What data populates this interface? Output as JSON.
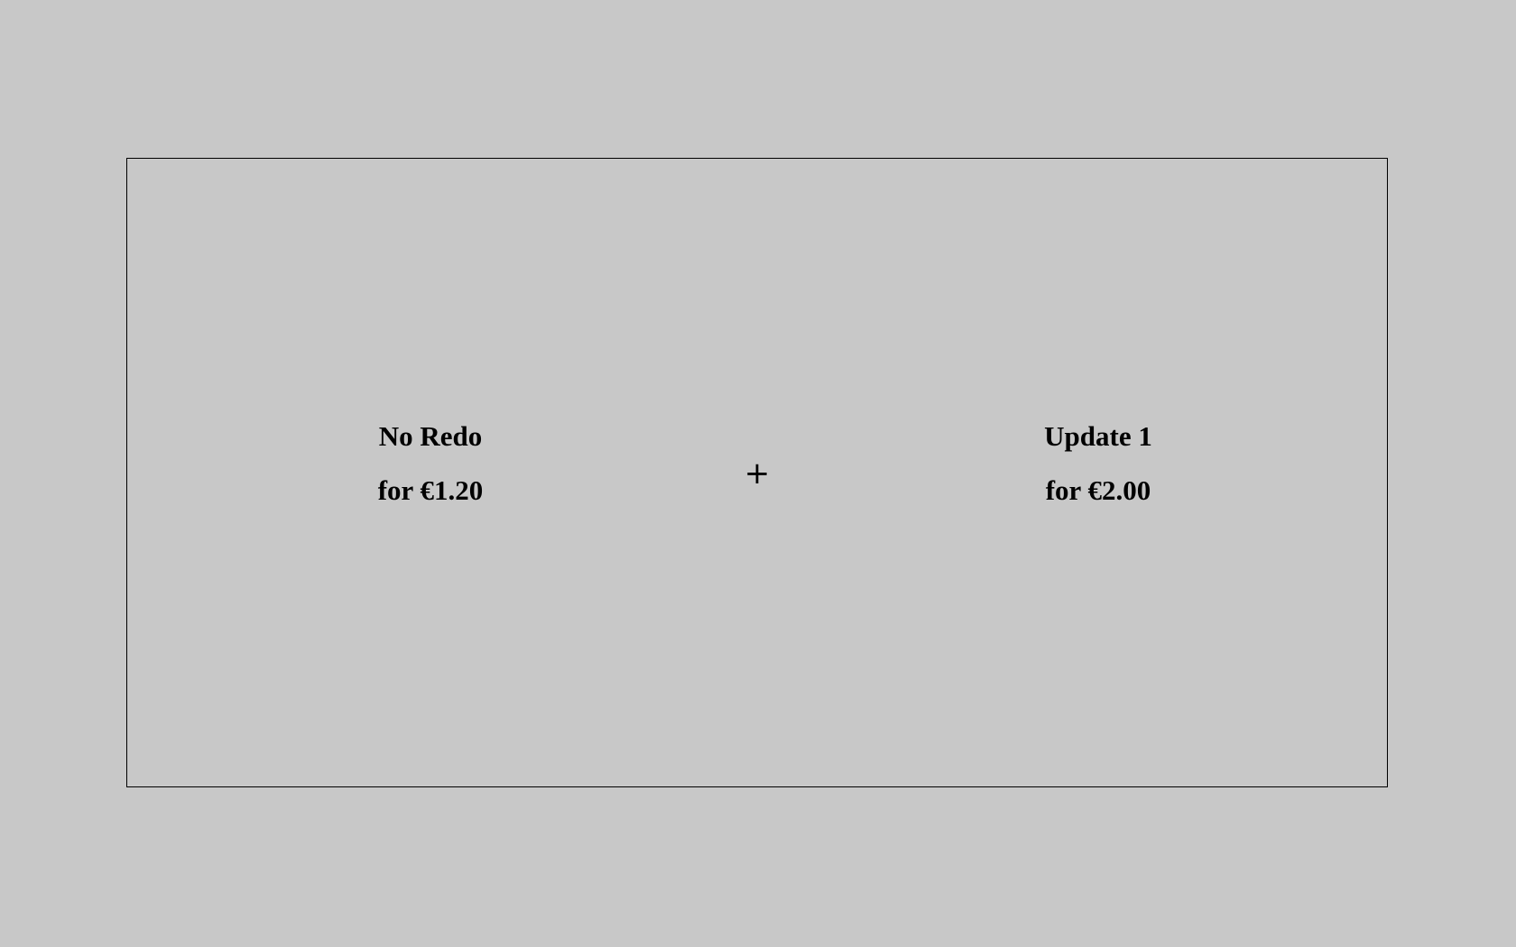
{
  "left_option": {
    "name": "No Redo",
    "price": "for €1.20"
  },
  "right_option": {
    "name": "Update 1",
    "price": "for €2.00"
  },
  "fixation": "+",
  "colors": {
    "background": "#c8c8c8",
    "text": "#000000",
    "frame_border": "#000000"
  }
}
